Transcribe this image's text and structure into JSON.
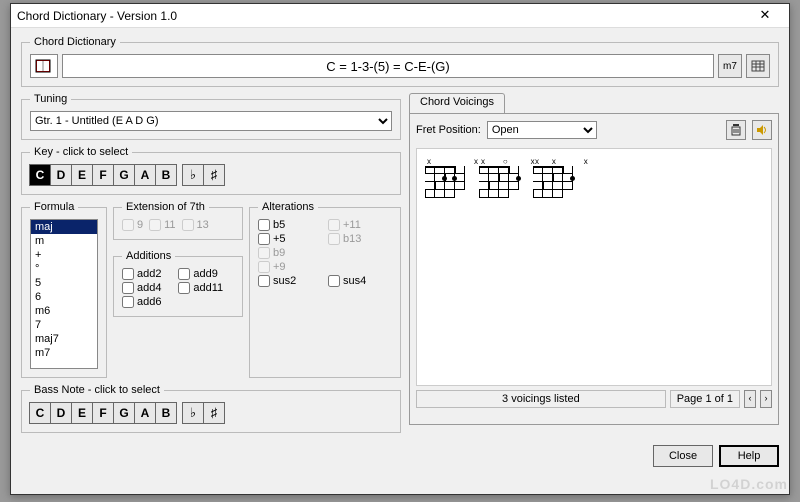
{
  "window": {
    "title": "Chord Dictionary - Version 1.0"
  },
  "chordDictionary": {
    "legend": "Chord Dictionary",
    "display": "C = 1-3-(5) = C-E-(G)",
    "suffixBtn": "m7"
  },
  "tuning": {
    "legend": "Tuning",
    "selected": "Gtr. 1 - Untitled (E A D G)"
  },
  "key": {
    "legend": "Key - click to select",
    "notes": [
      "C",
      "D",
      "E",
      "F",
      "G",
      "A",
      "B"
    ],
    "selected": "C",
    "flat": "♭",
    "sharp": "♯"
  },
  "formula": {
    "legend": "Formula",
    "items": [
      "maj",
      "m",
      "+",
      "°",
      "5",
      "6",
      "m6",
      "7",
      "maj7",
      "m7"
    ],
    "selected": "maj"
  },
  "ext7": {
    "legend": "Extension of 7th",
    "items": [
      {
        "label": "9",
        "enabled": false
      },
      {
        "label": "11",
        "enabled": false
      },
      {
        "label": "13",
        "enabled": false
      }
    ]
  },
  "additions": {
    "legend": "Additions",
    "items": [
      {
        "label": "add2"
      },
      {
        "label": "add9"
      },
      {
        "label": "add4"
      },
      {
        "label": "add11"
      },
      {
        "label": "add6"
      }
    ]
  },
  "alterations": {
    "legend": "Alterations",
    "items": [
      {
        "label": "b5",
        "enabled": true
      },
      {
        "label": "+11",
        "enabled": false
      },
      {
        "label": "+5",
        "enabled": true
      },
      {
        "label": "b13",
        "enabled": false
      },
      {
        "label": "b9",
        "enabled": false
      },
      {
        "label": "",
        "enabled": false
      },
      {
        "label": "+9",
        "enabled": false
      },
      {
        "label": "",
        "enabled": false
      },
      {
        "label": "sus2",
        "enabled": true
      },
      {
        "label": "sus4",
        "enabled": true
      }
    ]
  },
  "bassNote": {
    "legend": "Bass Note - click to select",
    "notes": [
      "C",
      "D",
      "E",
      "F",
      "G",
      "A",
      "B"
    ],
    "flat": "♭",
    "sharp": "♯"
  },
  "voicings": {
    "tabLabel": "Chord Voicings",
    "fretLabel": "Fret Position:",
    "fretValue": "Open",
    "status": "3 voicings listed",
    "page": "Page 1 of 1",
    "prev": "‹",
    "next": "›"
  },
  "buttons": {
    "close": "Close",
    "help": "Help"
  },
  "watermark": "LO4D.com"
}
